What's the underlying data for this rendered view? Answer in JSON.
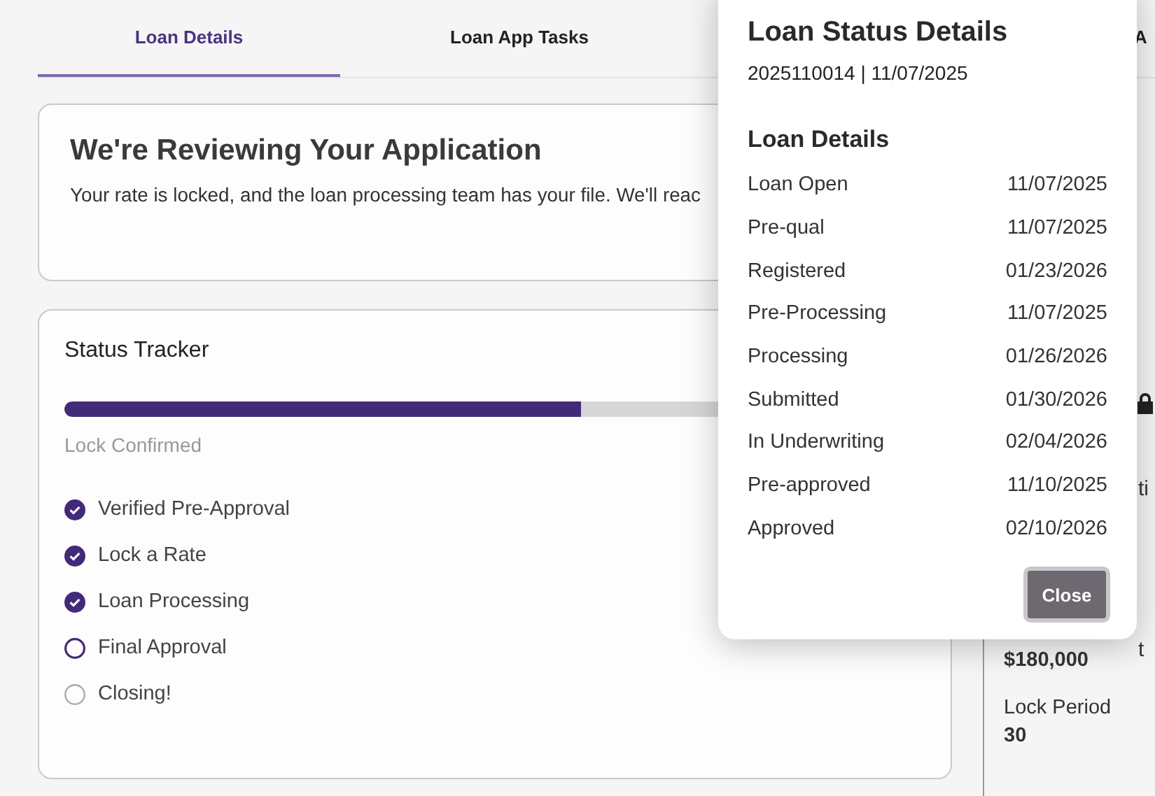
{
  "tabs": [
    {
      "label": "Loan Details",
      "selected": true
    },
    {
      "label": "Loan App Tasks",
      "selected": false
    },
    {
      "label": "A",
      "selected": false
    }
  ],
  "review_card": {
    "title": "We're Reviewing Your Application",
    "message": "Your rate is locked, and the loan processing team has your file. We'll reac"
  },
  "status_tracker": {
    "title": "Status Tracker",
    "progress": {
      "level": 0.6
    },
    "stage_label": "Lock Confirmed",
    "steps": [
      {
        "label": "Verified Pre-Approval",
        "checked": true,
        "current": false
      },
      {
        "label": "Lock a Rate",
        "checked": true,
        "current": false
      },
      {
        "label": "Loan Processing",
        "checked": true,
        "current": false
      },
      {
        "label": "Final Approval",
        "checked": false,
        "current": true
      },
      {
        "label": "Closing!",
        "checked": false,
        "current": false
      }
    ]
  },
  "side_panel": {
    "fragment_1": "ti",
    "fragment_2": "t",
    "fields": [
      {
        "value": "$180,000"
      },
      {
        "label": "Lock Period",
        "value": "30"
      }
    ]
  },
  "dialog": {
    "title": "Loan Status Details",
    "subtitle": "2025110014 | 11/07/2025",
    "section_title": "Loan Details",
    "rows": [
      {
        "label": "Loan Open",
        "date": "11/07/2025"
      },
      {
        "label": "Pre-qual",
        "date": "11/07/2025"
      },
      {
        "label": "Registered",
        "date": "01/23/2026"
      },
      {
        "label": "Pre-Processing",
        "date": "11/07/2025"
      },
      {
        "label": "Processing",
        "date": "01/26/2026"
      },
      {
        "label": "Submitted",
        "date": "01/30/2026"
      },
      {
        "label": "In Underwriting",
        "date": "02/04/2026"
      },
      {
        "label": "Pre-approved",
        "date": "11/10/2025"
      },
      {
        "label": "Approved",
        "date": "02/10/2026"
      }
    ],
    "close_button": "Close"
  }
}
